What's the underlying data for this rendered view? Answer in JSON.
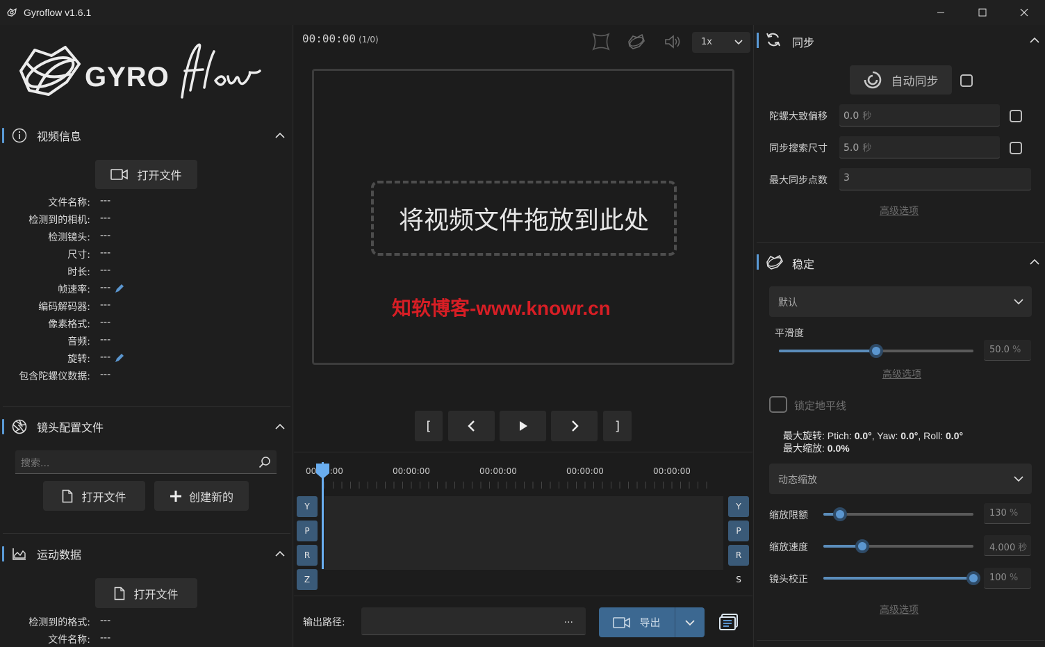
{
  "window": {
    "title": "Gyroflow v1.6.1"
  },
  "left": {
    "video_info": {
      "title": "视频信息",
      "open_file": "打开文件",
      "fields": [
        {
          "label": "文件名称:",
          "value": "---"
        },
        {
          "label": "检测到的相机:",
          "value": "---"
        },
        {
          "label": "检测镜头:",
          "value": "---"
        },
        {
          "label": "尺寸:",
          "value": "---"
        },
        {
          "label": "时长:",
          "value": "---"
        },
        {
          "label": "帧速率:",
          "value": "---"
        },
        {
          "label": "编码解码器:",
          "value": "---"
        },
        {
          "label": "像素格式:",
          "value": "---"
        },
        {
          "label": "音频:",
          "value": "---"
        },
        {
          "label": "旋转:",
          "value": "---"
        },
        {
          "label": "包含陀螺仪数据:",
          "value": "---"
        }
      ]
    },
    "lens_profile": {
      "title": "镜头配置文件",
      "search_placeholder": "搜索...",
      "open_file": "打开文件",
      "create_new": "创建新的"
    },
    "motion_data": {
      "title": "运动数据",
      "open_file": "打开文件",
      "fields": [
        {
          "label": "检测到的格式:",
          "value": "---"
        },
        {
          "label": "文件名称:",
          "value": "---"
        }
      ]
    }
  },
  "center": {
    "timecode": "00:00:00",
    "frame_info": "(1/0)",
    "speed": "1x",
    "drop_text": "将视频文件拖放到此处",
    "watermark": "知软博客-www.knowr.cn",
    "transport": {
      "mark_in": "[",
      "mark_out": "]"
    },
    "timeline": {
      "tick_labels": [
        "00:00:00",
        "00:00:00",
        "00:00:00",
        "00:00:00",
        "00:00:00"
      ],
      "axis_left": [
        "Y",
        "P",
        "R",
        "Z"
      ],
      "axis_right": [
        "Y",
        "P",
        "R",
        "S"
      ]
    },
    "output": {
      "label": "输出路径:",
      "dots": "...",
      "export": "导出"
    }
  },
  "right": {
    "sync": {
      "title": "同步",
      "auto_sync": "自动同步",
      "rows": [
        {
          "label": "陀螺大致偏移",
          "value": "0.0",
          "unit": "秒"
        },
        {
          "label": "同步搜索尺寸",
          "value": "5.0",
          "unit": "秒"
        },
        {
          "label": "最大同步点数",
          "value": "3",
          "unit": ""
        }
      ],
      "advanced": "高级选项"
    },
    "stabilization": {
      "title": "稳定",
      "method": "默认",
      "smoothness_label": "平滑度",
      "smoothness_value": "50.0",
      "smoothness_unit": "%",
      "smoothness_fraction": 0.5,
      "advanced": "高级选项",
      "lock_horizon": "锁定地平线",
      "max_rotation_prefix": "最大旋转: ",
      "pitch_label": "Ptich: ",
      "pitch": "0.0°",
      "yaw_label": ", Yaw: ",
      "yaw": "0.0°",
      "roll_label": ", Roll: ",
      "roll": "0.0°",
      "max_zoom_prefix": "最大缩放: ",
      "max_zoom": "0.0%",
      "zoom_mode": "动态缩放",
      "sliders": [
        {
          "label": "缩放限额",
          "value": "130",
          "unit": "%",
          "fraction": 0.11
        },
        {
          "label": "缩放速度",
          "value": "4.000",
          "unit": "秒",
          "fraction": 0.26
        },
        {
          "label": "镜头校正",
          "value": "100",
          "unit": "%",
          "fraction": 1.0
        }
      ],
      "advanced2": "高级选项"
    }
  },
  "colors": {
    "accent": "#5a9ad6",
    "export_bg": "#3c6891",
    "watermark": "#d71e25"
  }
}
